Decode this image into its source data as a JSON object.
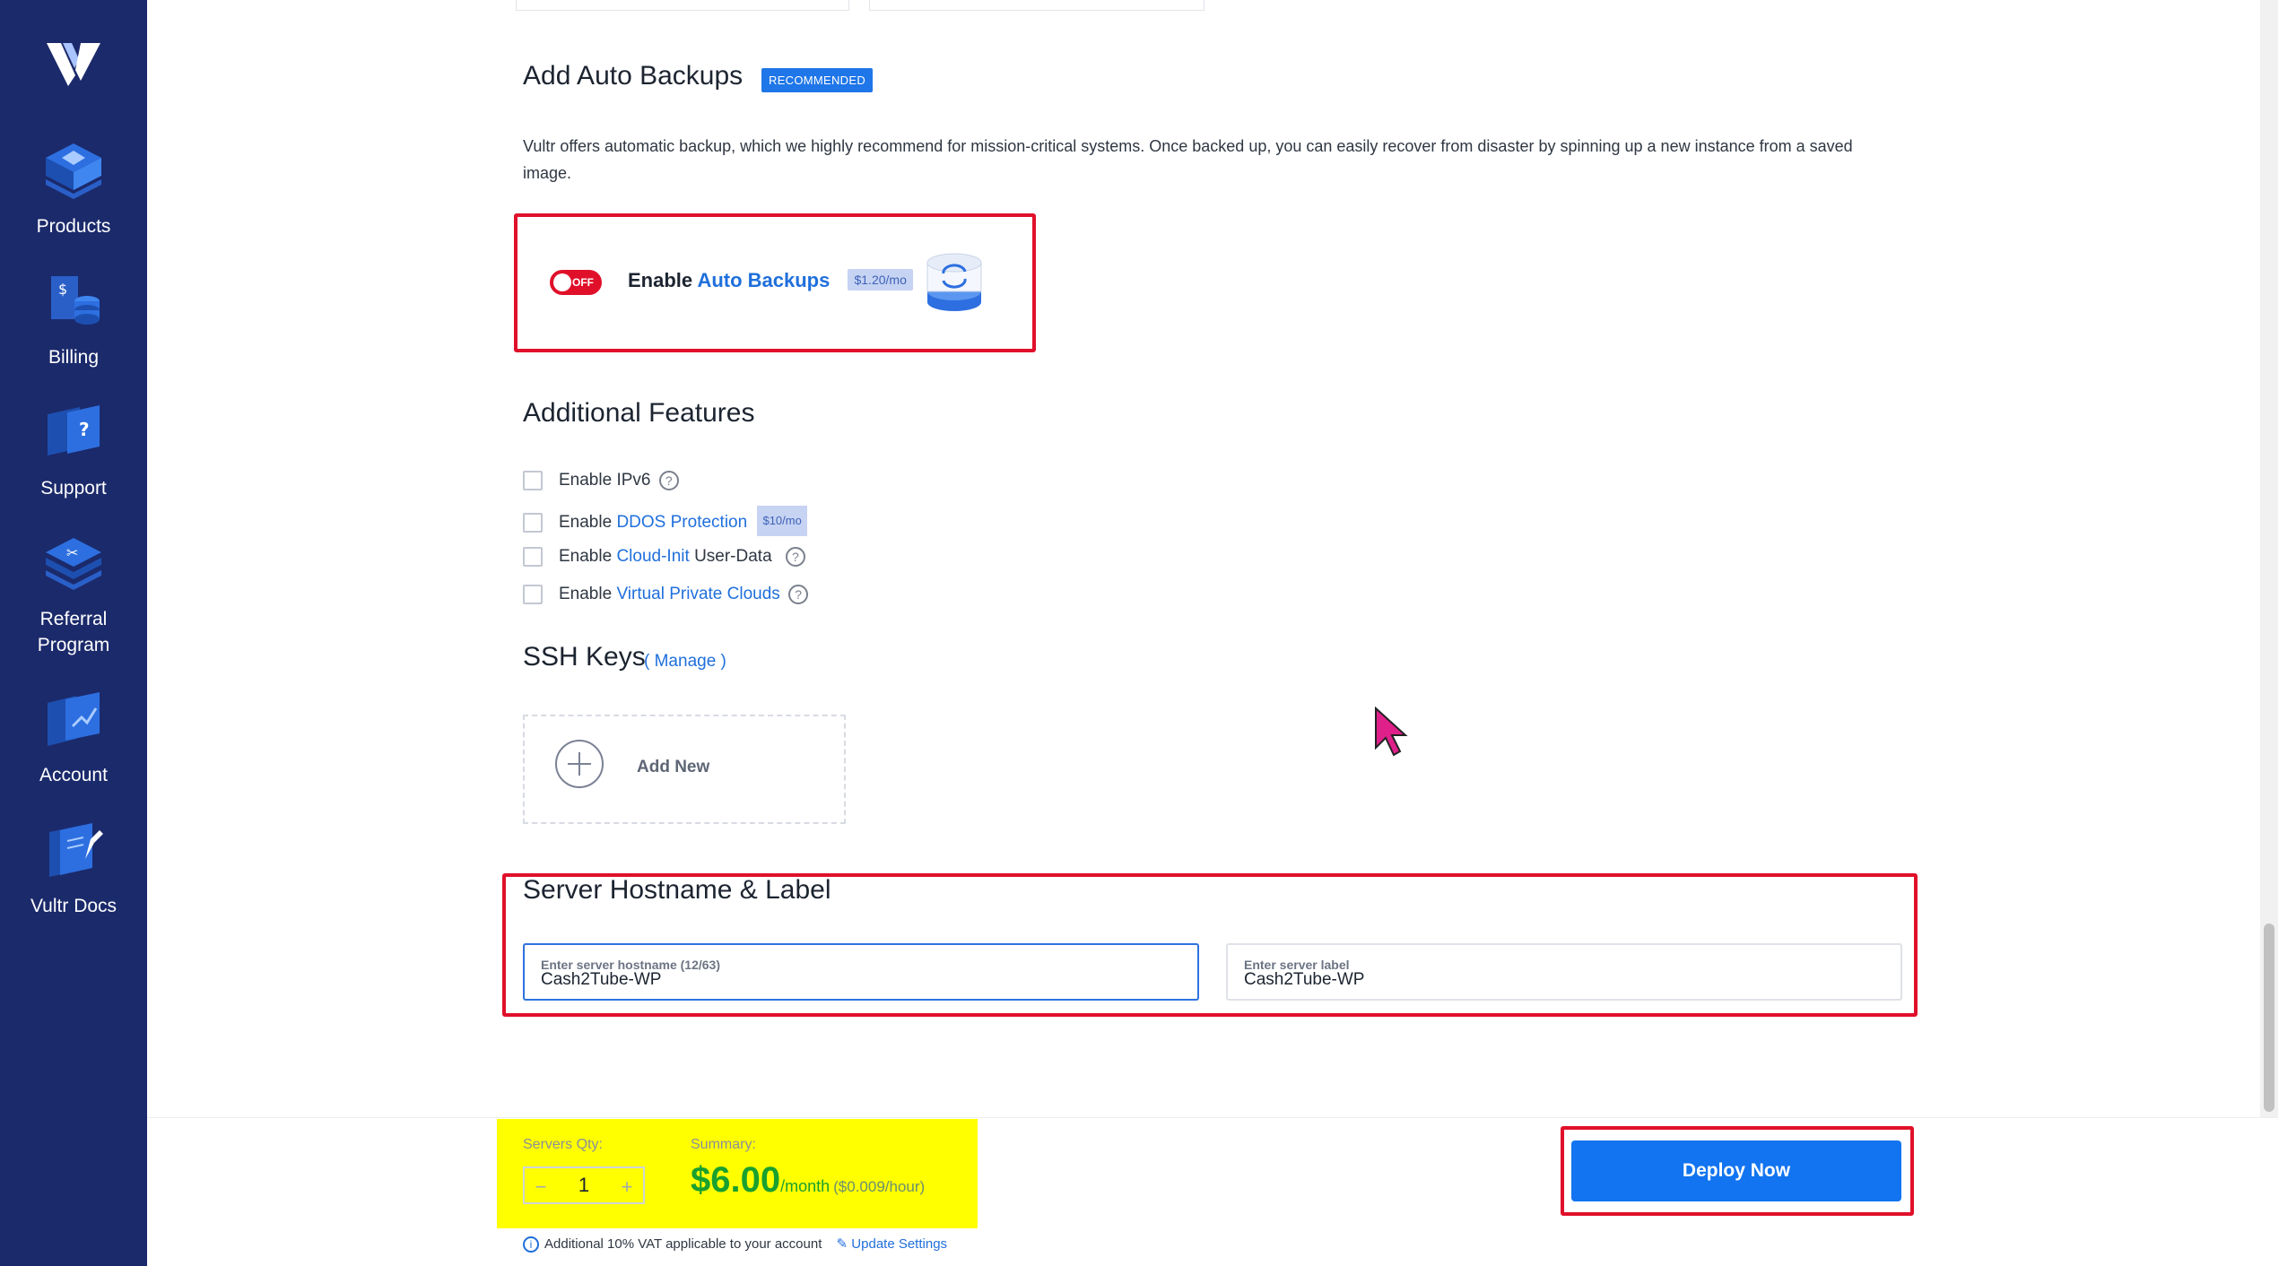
{
  "sidebar": {
    "items": [
      {
        "label": "Products"
      },
      {
        "label": "Billing"
      },
      {
        "label": "Support"
      },
      {
        "label_line1": "Referral",
        "label_line2": "Program"
      },
      {
        "label": "Account"
      },
      {
        "label": "Vultr Docs"
      }
    ]
  },
  "backups": {
    "title": "Add Auto Backups",
    "badge": "RECOMMENDED",
    "description": "Vultr offers automatic backup, which we highly recommend for mission-critical systems. Once backed up, you can easily recover from disaster by spinning up a new instance from a saved image.",
    "toggle_state": "OFF",
    "enable_prefix": "Enable",
    "enable_link": "Auto Backups",
    "price": "$1.20/mo"
  },
  "additional": {
    "title": "Additional Features",
    "features": [
      {
        "prefix": "Enable IPv6",
        "link": "",
        "suffix": "",
        "has_help": true
      },
      {
        "prefix": "Enable",
        "link": "DDOS Protection",
        "badge": "$10/mo"
      },
      {
        "prefix": "Enable",
        "link": "Cloud-Init",
        "suffix": "User-Data",
        "has_help": true
      },
      {
        "prefix": "Enable",
        "link": "Virtual Private Clouds",
        "has_help": true
      }
    ]
  },
  "ssh": {
    "title": "SSH Keys",
    "manage_label": "( Manage )",
    "add_new_label": "Add New"
  },
  "hostname": {
    "title": "Server Hostname & Label",
    "hostname_label": "Enter server hostname (12/63)",
    "hostname_value": "Cash2Tube-WP",
    "label_label": "Enter server label",
    "label_value": "Cash2Tube-WP"
  },
  "footer": {
    "qty_label": "Servers Qty:",
    "qty_value": "1",
    "minus": "−",
    "plus": "+",
    "summary_label": "Summary:",
    "price": "$6.00",
    "per": "/month",
    "hourly": "($0.009/hour)",
    "vat_text": "Additional 10% VAT applicable to your account",
    "update_settings": "Update Settings",
    "deploy_label": "Deploy Now"
  },
  "colors": {
    "sidebar_bg": "#1b2a6b",
    "accent": "#1274f0",
    "highlight_red": "#e0102a",
    "highlight_yellow": "#ffff00",
    "price_green": "#1aa02e"
  }
}
